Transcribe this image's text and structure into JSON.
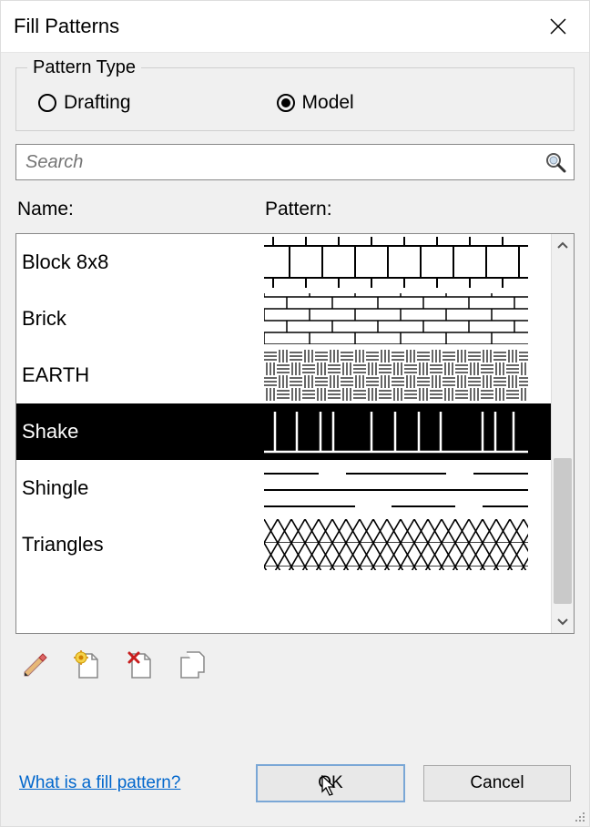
{
  "dialog": {
    "title": "Fill Patterns",
    "pattern_type_legend": "Pattern Type",
    "radios": {
      "drafting": "Drafting",
      "model": "Model",
      "selected": "model"
    },
    "search_placeholder": "Search",
    "columns": {
      "name": "Name:",
      "pattern": "Pattern:"
    },
    "items": [
      {
        "name": "Block 8x8",
        "pattern_key": "block8x8",
        "selected": false
      },
      {
        "name": "Brick",
        "pattern_key": "brick",
        "selected": false
      },
      {
        "name": "EARTH",
        "pattern_key": "earth",
        "selected": false
      },
      {
        "name": "Shake",
        "pattern_key": "shake",
        "selected": true
      },
      {
        "name": "Shingle",
        "pattern_key": "shingle",
        "selected": false
      },
      {
        "name": "Triangles",
        "pattern_key": "triangles",
        "selected": false
      }
    ],
    "toolbar_icons": [
      "edit-icon",
      "new-icon",
      "delete-icon",
      "duplicate-icon"
    ],
    "help_link": "What is a fill pattern?",
    "ok_label": "OK",
    "cancel_label": "Cancel"
  }
}
